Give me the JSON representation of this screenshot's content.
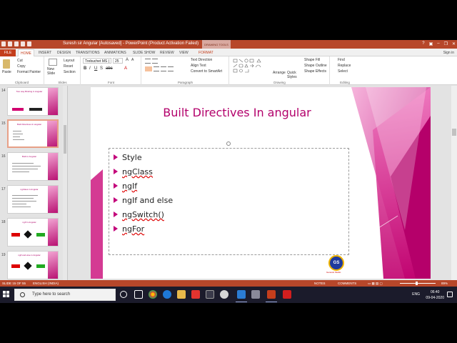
{
  "window": {
    "title": "Suresh sir Angular [Autosaved] - PowerPoint (Product Activation Failed)",
    "contextual_group": "DRAWING TOOLS",
    "sign_in": "Sign in"
  },
  "ribbon_tabs": [
    "FILE",
    "HOME",
    "INSERT",
    "DESIGN",
    "TRANSITIONS",
    "ANIMATIONS",
    "SLIDE SHOW",
    "REVIEW",
    "VIEW",
    "FORMAT"
  ],
  "ribbon": {
    "clipboard": {
      "paste": "Paste",
      "cut": "Cut",
      "copy": "Copy",
      "format_painter": "Format Painter",
      "label": "Clipboard"
    },
    "slides": {
      "new_slide": "New Slide",
      "layout": "Layout",
      "reset": "Reset",
      "section": "Section",
      "label": "Slides"
    },
    "font": {
      "name": "Trebuchet MS (",
      "size": "25",
      "label": "Font"
    },
    "paragraph": {
      "text_direction": "Text Direction",
      "align_text": "Align Text",
      "smartart": "Convert to SmartArt",
      "label": "Paragraph"
    },
    "drawing": {
      "arrange": "Arrange",
      "quick_styles": "Quick Styles",
      "shape_fill": "Shape Fill",
      "shape_outline": "Shape Outline",
      "shape_effects": "Shape Effects",
      "label": "Drawing"
    },
    "editing": {
      "find": "Find",
      "replace": "Replace",
      "select": "Select",
      "label": "Editing"
    }
  },
  "thumbnails": [
    {
      "num": "14",
      "title": "Two way Binding in Angular"
    },
    {
      "num": "15",
      "title": "Built Directives In angular"
    },
    {
      "num": "16",
      "title": "Built in Angular"
    },
    {
      "num": "17",
      "title": "ngClass in Angular"
    },
    {
      "num": "18",
      "title": "ngIf in Angular"
    },
    {
      "num": "19",
      "title": "ngIf and else in Angular"
    }
  ],
  "slide": {
    "title": "Built Directives In angular",
    "bullets": [
      "Style",
      "ngClass",
      "ngIf",
      "ngIf and else",
      "ngSwitch()",
      "ngFor"
    ],
    "logo": "GS",
    "logo_sub": "Genesis Studio"
  },
  "statusbar": {
    "slide_info": "SLIDE 15 OF 55",
    "language": "ENGLISH (INDIA)",
    "notes": "NOTES",
    "comments": "COMMENTS",
    "zoom": "89%"
  },
  "taskbar": {
    "search_placeholder": "Type here to search",
    "lang": "ENG",
    "time": "06:40",
    "date": "09-04-2020"
  },
  "colors": {
    "accent": "#b7472a",
    "slide_title": "#b3006b",
    "bullet": "#c3007a"
  }
}
